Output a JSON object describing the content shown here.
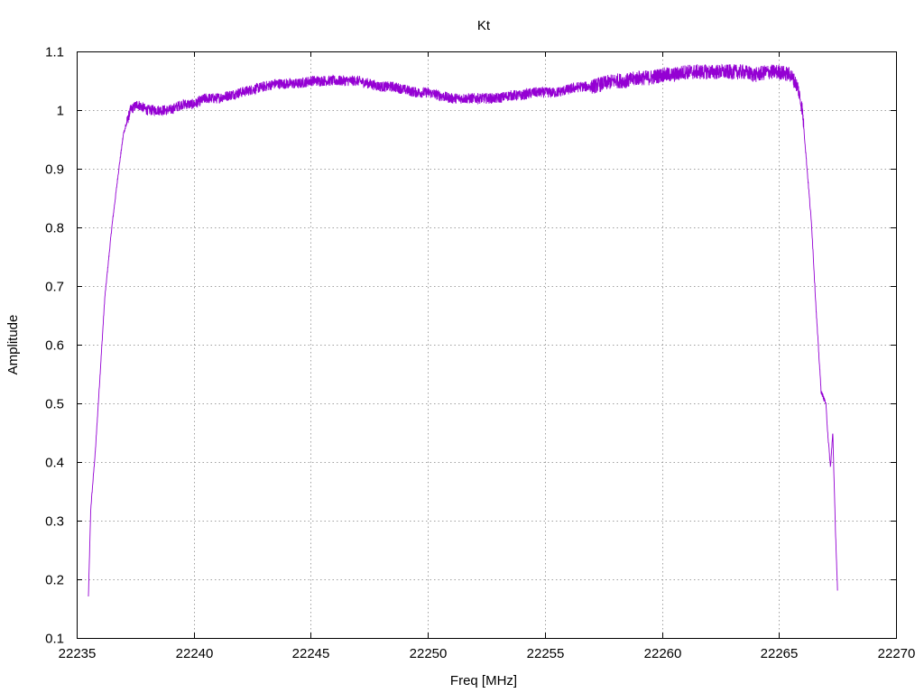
{
  "chart_data": {
    "type": "line",
    "title": "Kt",
    "xlabel": "Freq [MHz]",
    "ylabel": "Amplitude",
    "xlim": [
      22235,
      22270
    ],
    "ylim": [
      0.1,
      1.1
    ],
    "xticks": [
      22235,
      22240,
      22245,
      22250,
      22255,
      22260,
      22265,
      22270
    ],
    "yticks": [
      0.1,
      0.2,
      0.3,
      0.4,
      0.5,
      0.6,
      0.7,
      0.8,
      0.9,
      1,
      1.1
    ],
    "xtick_labels": [
      "22235",
      "22240",
      "22245",
      "22250",
      "22255",
      "22260",
      "22265",
      "22270"
    ],
    "ytick_labels": [
      "0.1",
      "0.2",
      "0.3",
      "0.4",
      "0.5",
      "0.6",
      "0.7",
      "0.8",
      "0.9",
      "1",
      "1.1"
    ],
    "grid": true,
    "series": [
      {
        "color": "#9400d3",
        "x": [
          22235.5,
          22235.6,
          22235.8,
          22236.0,
          22236.2,
          22236.5,
          22236.8,
          22237.0,
          22237.3,
          22237.6,
          22238.0,
          22238.5,
          22239.0,
          22239.5,
          22240.0,
          22240.5,
          22241.0,
          22241.5,
          22242.0,
          22242.5,
          22243.0,
          22243.5,
          22244.0,
          22244.5,
          22245.0,
          22245.5,
          22246.0,
          22246.5,
          22247.0,
          22247.5,
          22248.0,
          22248.5,
          22249.0,
          22249.5,
          22250.0,
          22250.5,
          22251.0,
          22251.5,
          22252.0,
          22252.5,
          22253.0,
          22253.5,
          22254.0,
          22254.5,
          22255.0,
          22255.5,
          22256.0,
          22256.5,
          22257.0,
          22257.5,
          22258.0,
          22258.5,
          22259.0,
          22259.5,
          22260.0,
          22260.5,
          22261.0,
          22261.5,
          22262.0,
          22262.5,
          22263.0,
          22263.5,
          22264.0,
          22264.5,
          22265.0,
          22265.5,
          22265.8,
          22266.0,
          22266.2,
          22266.4,
          22266.6,
          22266.8,
          22267.0,
          22267.1,
          22267.2,
          22267.3,
          22267.4,
          22267.5
        ],
        "y": [
          0.17,
          0.32,
          0.42,
          0.55,
          0.68,
          0.8,
          0.9,
          0.96,
          1.0,
          1.01,
          1.0,
          1.0,
          1.0,
          1.01,
          1.01,
          1.02,
          1.02,
          1.025,
          1.03,
          1.035,
          1.04,
          1.045,
          1.045,
          1.045,
          1.05,
          1.05,
          1.05,
          1.05,
          1.05,
          1.045,
          1.04,
          1.04,
          1.035,
          1.03,
          1.03,
          1.025,
          1.02,
          1.02,
          1.02,
          1.02,
          1.02,
          1.025,
          1.025,
          1.03,
          1.03,
          1.03,
          1.035,
          1.04,
          1.04,
          1.045,
          1.05,
          1.05,
          1.055,
          1.055,
          1.06,
          1.06,
          1.065,
          1.065,
          1.065,
          1.065,
          1.065,
          1.065,
          1.06,
          1.065,
          1.065,
          1.06,
          1.04,
          1.0,
          0.9,
          0.8,
          0.65,
          0.52,
          0.5,
          0.44,
          0.39,
          0.45,
          0.3,
          0.18
        ]
      }
    ]
  }
}
